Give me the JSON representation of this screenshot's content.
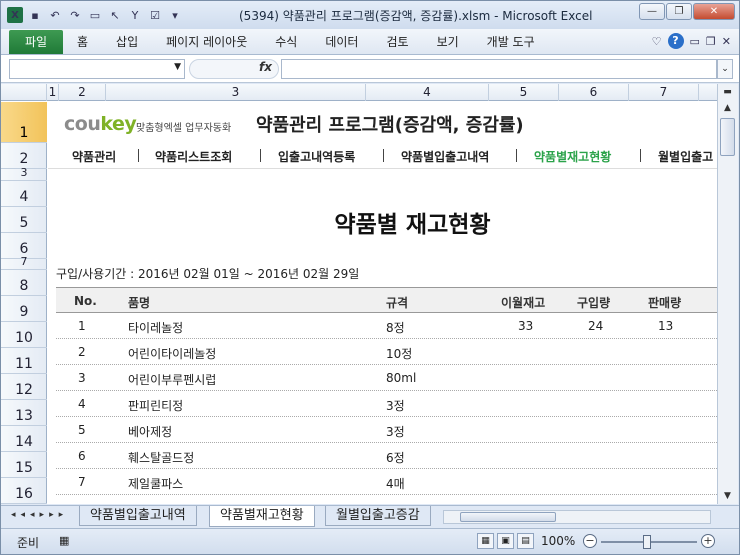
{
  "window": {
    "title": "(5394) 약품관리 프로그램(증감액, 증감률).xlsm  -  Microsoft Excel"
  },
  "ribbon": {
    "file_tab": "파일",
    "tabs": [
      "홈",
      "삽입",
      "페이지 레이아웃",
      "수식",
      "데이터",
      "검토",
      "보기",
      "개발 도구"
    ]
  },
  "formula_bar": {
    "name_box": "",
    "fx": "fx",
    "content": ""
  },
  "columns": [
    "1",
    "2",
    "3",
    "4",
    "5",
    "6",
    "7"
  ],
  "rows": [
    "1",
    "2",
    "3",
    "4",
    "5",
    "6",
    "7",
    "8",
    "9",
    "10",
    "11",
    "12",
    "13",
    "14",
    "15",
    "16"
  ],
  "header": {
    "brand_prefix": "cou",
    "brand_suffix": "key",
    "tagline": "맞춤형엑셀 업무자동화",
    "app_title": "약품관리 프로그램(증감액, 증감률)"
  },
  "nav": [
    "약품관리",
    "약품리스트조회",
    "입출고내역등록",
    "약품별입출고내역",
    "약품별재고현황",
    "월별입출고"
  ],
  "page_title": "약품별 재고현황",
  "period": "구입/사용기간 : 2016년 02월 01일 ~ 2016년 02월 29일",
  "table": {
    "headers": [
      "No.",
      "품명",
      "규격",
      "이월재고",
      "구입량",
      "판매량"
    ],
    "rows": [
      [
        "1",
        "타이레놀정",
        "8정",
        "33",
        "24",
        "13"
      ],
      [
        "2",
        "어린이타이레놀정",
        "10정",
        "",
        "",
        ""
      ],
      [
        "3",
        "어린이부루펜시럽",
        "80ml",
        "",
        "",
        ""
      ],
      [
        "4",
        "판피린티정",
        "3정",
        "",
        "",
        ""
      ],
      [
        "5",
        "베아제정",
        "3정",
        "",
        "",
        ""
      ],
      [
        "6",
        "훼스탈골드정",
        "6정",
        "",
        "",
        ""
      ],
      [
        "7",
        "제일쿨파스",
        "4매",
        "",
        "",
        ""
      ]
    ]
  },
  "sheet_tabs": [
    "약품별입출고내역",
    "약품별재고현황",
    "월별입출고증감"
  ],
  "status": {
    "ready": "준비",
    "zoom": "100%"
  },
  "colors": {
    "active_nav": "#2ba34a",
    "file_tab": "#1f7a37"
  }
}
